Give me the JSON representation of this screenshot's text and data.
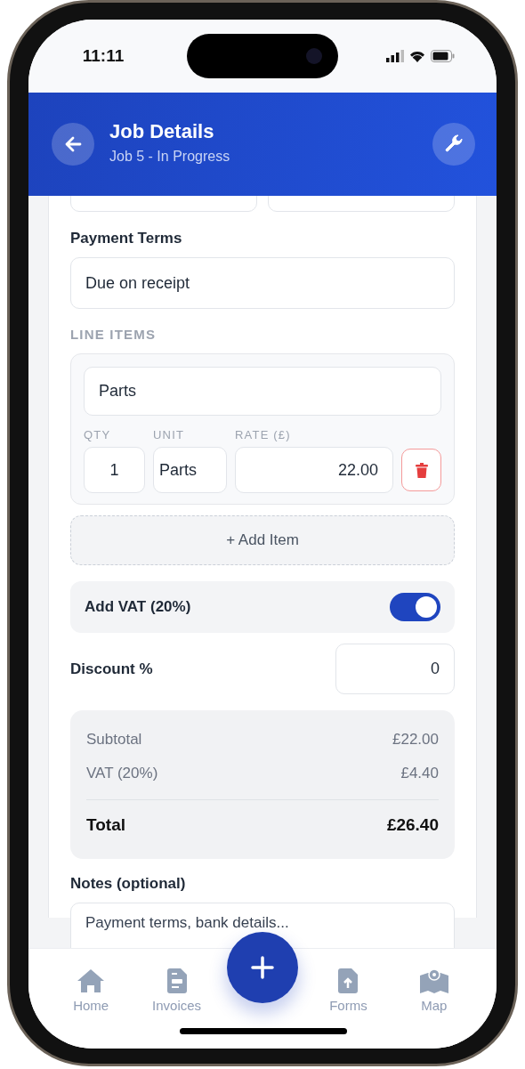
{
  "status_bar": {
    "time": "11:11"
  },
  "header": {
    "title": "Job Details",
    "subtitle": "Job 5 - In Progress"
  },
  "payment_terms": {
    "label": "Payment Terms",
    "value": "Due on receipt"
  },
  "line_items": {
    "heading": "LINE ITEMS",
    "column_labels": [
      "QTY",
      "UNIT",
      "RATE (£)"
    ],
    "items": [
      {
        "description": "Parts",
        "qty": "1",
        "unit": "Parts",
        "rate": "22.00"
      }
    ],
    "add_button": "+ Add Item"
  },
  "vat": {
    "label": "Add VAT (20%)",
    "on": true
  },
  "discount": {
    "label": "Discount %",
    "value": "0"
  },
  "summary": [
    {
      "label": "Subtotal",
      "value": "£22.00",
      "kind": "line"
    },
    {
      "label": "VAT (20%)",
      "value": "£4.40",
      "kind": "line"
    },
    {
      "label": "Total",
      "value": "£26.40",
      "kind": "total"
    }
  ],
  "notes": {
    "label": "Notes (optional)",
    "placeholder": "Payment terms, bank details..."
  },
  "nav": [
    {
      "label": "Home",
      "kind": "home"
    },
    {
      "label": "Invoices",
      "kind": "invoice"
    },
    {
      "kind": "fab"
    },
    {
      "label": "Forms",
      "kind": "upload"
    },
    {
      "label": "Map",
      "kind": "map"
    }
  ]
}
